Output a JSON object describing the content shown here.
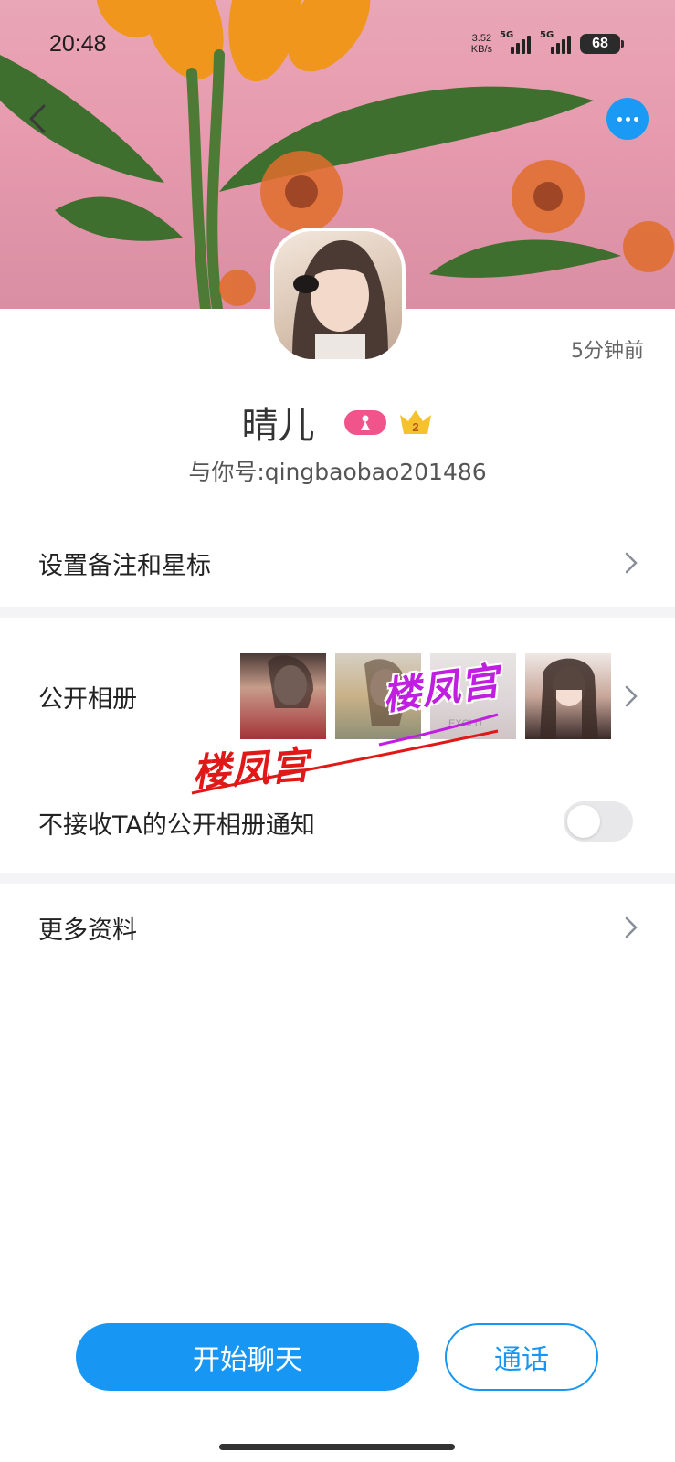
{
  "status_bar": {
    "time": "20:48",
    "net_speed_value": "3.52",
    "net_speed_unit": "KB/s",
    "signal1_label": "5G",
    "signal2_label": "5G",
    "battery": "68"
  },
  "profile": {
    "last_seen": "5分钟前",
    "nickname": "晴儿",
    "vip_level": "2",
    "qid": "与你号:qingbaobao201486"
  },
  "menu": {
    "remark": "设置备注和星标",
    "album": "公开相册",
    "mute_album": "不接收TA的公开相册通知",
    "mute_album_on": false,
    "more_info": "更多资料"
  },
  "watermarks": [
    "楼凤宫",
    "楼凤宫"
  ],
  "actions": {
    "chat": "开始聊天",
    "call": "通话"
  },
  "colors": {
    "accent": "#1797f3",
    "badge_pink": "#f0548a",
    "crown_gold": "#f5c12c"
  },
  "icons": [
    "back-icon",
    "more-icon",
    "chevron-right-icon",
    "gender-female-icon",
    "crown-icon"
  ]
}
